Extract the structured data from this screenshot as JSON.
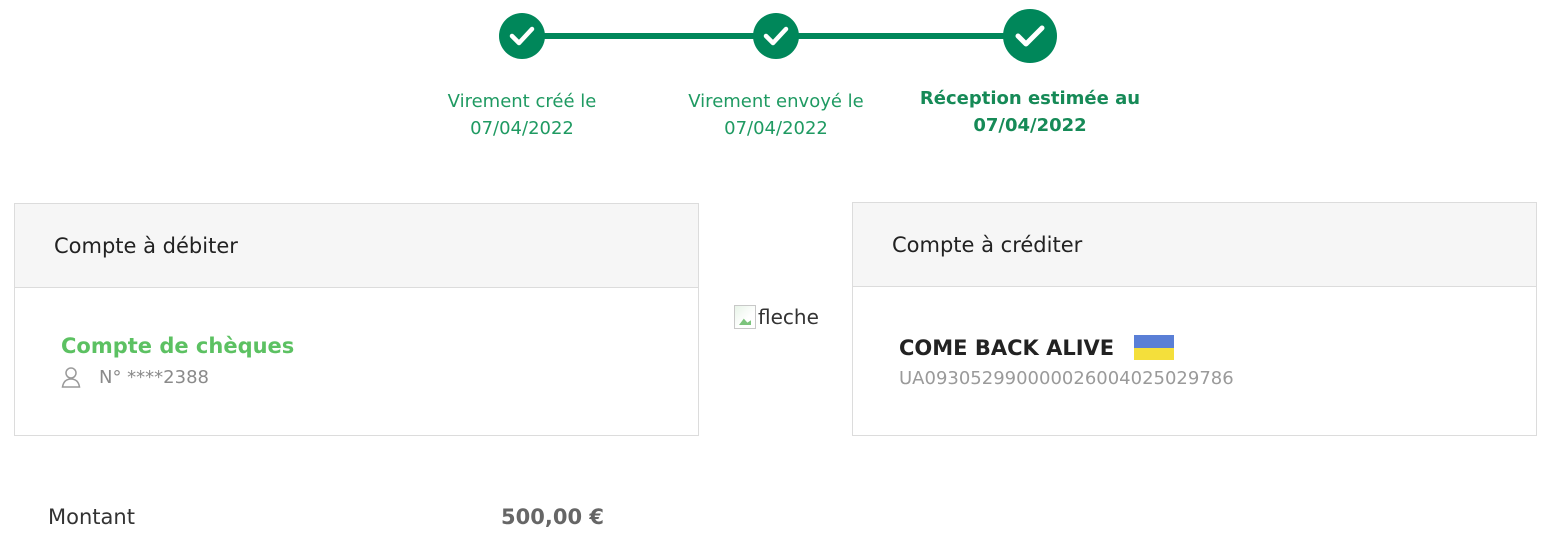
{
  "colors": {
    "accent": "#00875a",
    "account_name": "#5cc162",
    "flag_blue": "#5a7fd6",
    "flag_yellow": "#f4df3b"
  },
  "steps": [
    {
      "line1": "Virement créé le",
      "line2": "07/04/2022",
      "icon": "check-icon",
      "status": "done"
    },
    {
      "line1": "Virement envoyé le",
      "line2": "07/04/2022",
      "icon": "check-icon",
      "status": "done"
    },
    {
      "line1": "Réception estimée au",
      "line2": "07/04/2022",
      "icon": "check-icon",
      "status": "current"
    }
  ],
  "debit": {
    "title": "Compte à débiter",
    "account_name": "Compte de chèques",
    "account_number": "N° ****2388",
    "icon": "user-icon"
  },
  "arrow": {
    "alt": "fleche",
    "icon": "broken-image-icon"
  },
  "credit": {
    "title": "Compte à créditer",
    "beneficiary": "COME BACK ALIVE",
    "iban": "UA093052990000026004025029786",
    "flag_icon": "ukraine-flag-icon"
  },
  "amount": {
    "label": "Montant",
    "value": "500,00 €"
  }
}
